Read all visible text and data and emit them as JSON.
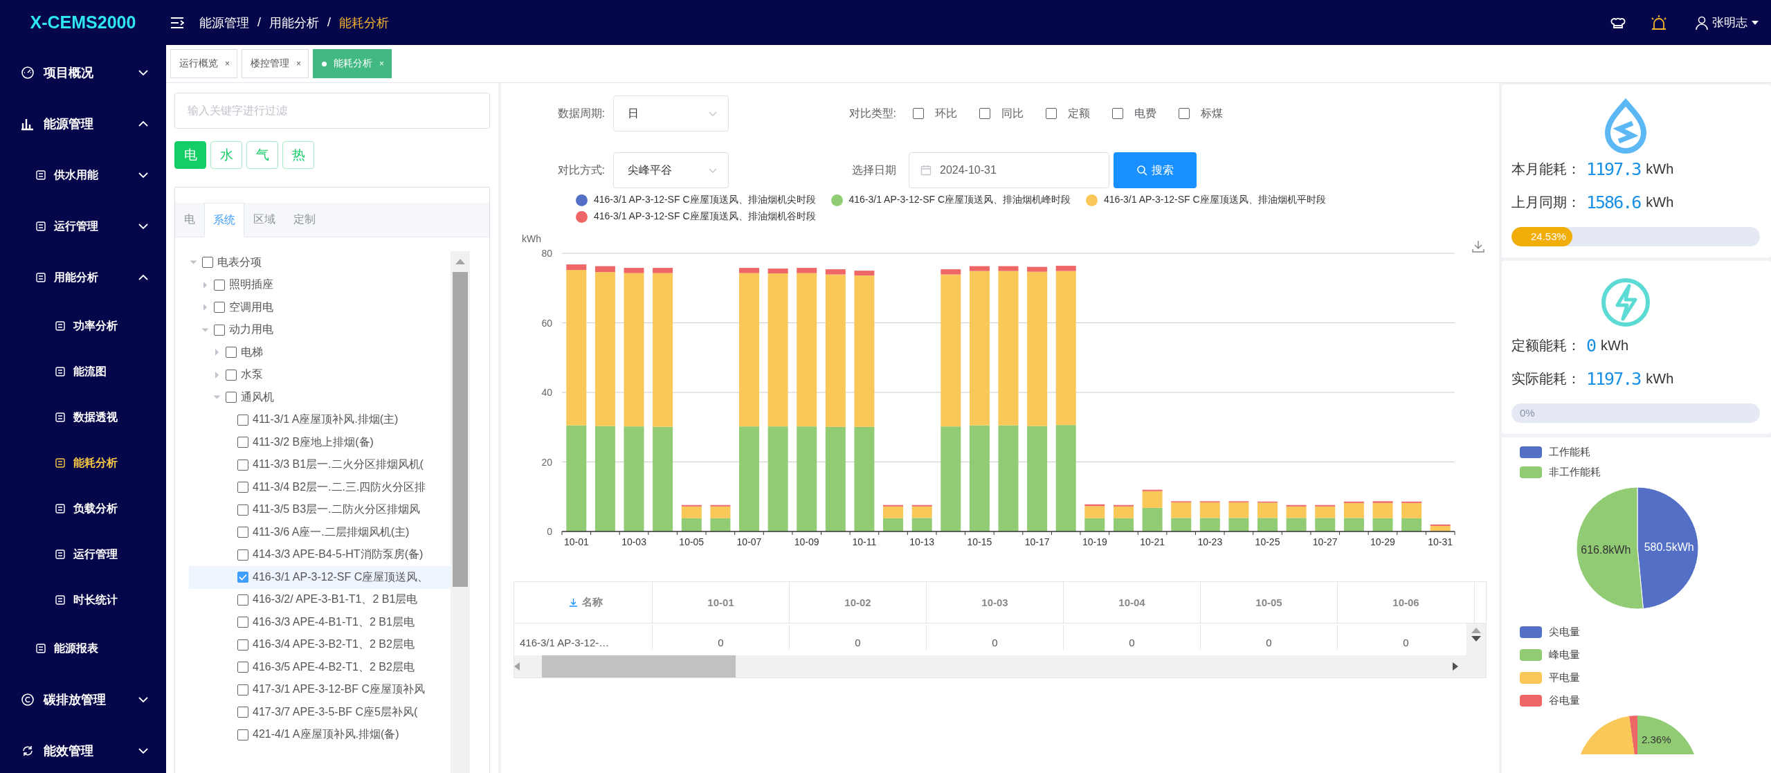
{
  "header": {
    "logo": "X-CEMS2000",
    "breadcrumb": [
      {
        "label": "能源管理",
        "selected": false
      },
      {
        "label": "用能分析",
        "selected": false
      },
      {
        "label": "能耗分析",
        "selected": true
      }
    ],
    "separator": "/",
    "user": "张明志"
  },
  "sidebar": {
    "items": [
      {
        "label": "项目概况",
        "expanded": false,
        "selected": false
      },
      {
        "label": "能源管理",
        "expanded": true,
        "selected": false,
        "children": [
          {
            "label": "供水用能",
            "expanded": false,
            "selected": false
          },
          {
            "label": "运行管理",
            "expanded": false,
            "selected": false
          },
          {
            "label": "用能分析",
            "expanded": true,
            "selected": false,
            "children": [
              {
                "label": "功率分析",
                "selected": false
              },
              {
                "label": "能流图",
                "selected": false
              },
              {
                "label": "数据透视",
                "selected": false
              },
              {
                "label": "能耗分析",
                "selected": true
              },
              {
                "label": "负载分析",
                "selected": false
              },
              {
                "label": "运行管理",
                "selected": false
              },
              {
                "label": "时长统计",
                "selected": false
              }
            ]
          },
          {
            "label": "能源报表",
            "selected": false
          }
        ]
      },
      {
        "label": "碳排放管理",
        "expanded": false,
        "selected": false
      },
      {
        "label": "能效管理",
        "expanded": false,
        "selected": false
      }
    ]
  },
  "tabs": [
    {
      "label": "运行概览",
      "close": "×",
      "selected": false
    },
    {
      "label": "楼控管理",
      "close": "×",
      "selected": false
    },
    {
      "label": "能耗分析",
      "close": "×",
      "selected": true
    }
  ],
  "left_panel": {
    "filter": {
      "placeholder": "输入关键字进行过滤"
    },
    "energy_types": [
      {
        "label": "电",
        "selected": true
      },
      {
        "label": "水",
        "selected": false
      },
      {
        "label": "气",
        "selected": false
      },
      {
        "label": "热",
        "selected": false
      }
    ],
    "tree_tabs": [
      {
        "label": "电",
        "selected": false
      },
      {
        "label": "系统",
        "selected": true
      },
      {
        "label": "区域",
        "selected": false
      },
      {
        "label": "定制",
        "selected": false
      }
    ],
    "tree": [
      {
        "label": "电表分项",
        "checked": false,
        "selected": false,
        "expanded": true,
        "children": [
          {
            "label": "照明插座",
            "checked": false,
            "selected": false,
            "expanded": false
          },
          {
            "label": "空调用电",
            "checked": false,
            "selected": false,
            "expanded": false
          },
          {
            "label": "动力用电",
            "checked": false,
            "selected": false,
            "expanded": true,
            "children": [
              {
                "label": "电梯",
                "checked": false,
                "selected": false,
                "expanded": false
              },
              {
                "label": "水泵",
                "checked": false,
                "selected": false,
                "expanded": false
              },
              {
                "label": "通风机",
                "checked": false,
                "selected": false,
                "expanded": true,
                "children": [
                  {
                    "label": "411-3/1 A座屋顶补风.排烟(主)",
                    "checked": false,
                    "selected": false
                  },
                  {
                    "label": "411-3/2 B座地上排烟(备)",
                    "checked": false,
                    "selected": false
                  },
                  {
                    "label": "411-3/3 B1层一.二火分区排烟风机(",
                    "checked": false,
                    "selected": false
                  },
                  {
                    "label": "411-3/4 B2层一.二.三.四防火分区排",
                    "checked": false,
                    "selected": false
                  },
                  {
                    "label": "411-3/5 B3层一.二防火分区排烟风",
                    "checked": false,
                    "selected": false
                  },
                  {
                    "label": "411-3/6 A座一.二层排烟风机(主)",
                    "checked": false,
                    "selected": false
                  },
                  {
                    "label": "414-3/3 APE-B4-5-HT消防泵房(备)",
                    "checked": false,
                    "selected": false
                  },
                  {
                    "label": "416-3/1 AP-3-12-SF C座屋顶送风、",
                    "checked": true,
                    "selected": true
                  },
                  {
                    "label": "416-3/2/ APE-3-B1-T1、2 B1层电",
                    "checked": false,
                    "selected": false
                  },
                  {
                    "label": "416-3/3 APE-4-B1-T1、2 B1层电",
                    "checked": false,
                    "selected": false
                  },
                  {
                    "label": "416-3/4 APE-3-B2-T1、2 B2层电",
                    "checked": false,
                    "selected": false
                  },
                  {
                    "label": "416-3/5 APE-4-B2-T1、2 B2层电",
                    "checked": false,
                    "selected": false
                  },
                  {
                    "label": "417-3/1 APE-3-12-BF C座屋顶补风",
                    "checked": false,
                    "selected": false
                  },
                  {
                    "label": "417-3/7 APE-3-5-BF C座5层补风(",
                    "checked": false,
                    "selected": false
                  },
                  {
                    "label": "421-4/1 A座屋顶补风.排烟(备)",
                    "checked": false,
                    "selected": false
                  }
                ]
              }
            ]
          }
        ]
      }
    ]
  },
  "filters": {
    "period": {
      "label": "数据周期:",
      "value": "日"
    },
    "compare_types": {
      "label": "对比类型:",
      "options": [
        {
          "label": "环比",
          "checked": false
        },
        {
          "label": "同比",
          "checked": false
        },
        {
          "label": "定额",
          "checked": false
        },
        {
          "label": "电费",
          "checked": false
        },
        {
          "label": "标煤",
          "checked": false
        }
      ]
    },
    "compare_mode": {
      "label": "对比方式:",
      "value": "尖峰平谷"
    },
    "date": {
      "label": "选择日期",
      "value": "2024-10-31"
    },
    "search_button": "搜索"
  },
  "chart": {
    "chart_data": {
      "type": "bar",
      "stacked": true,
      "ylabel": "kWh",
      "ylim": [
        0,
        80
      ],
      "yticks": [
        0,
        20,
        40,
        60,
        80
      ],
      "grid": true,
      "legend": true,
      "categories": [
        "10-01",
        null,
        "10-03",
        null,
        "10-05",
        null,
        "10-07",
        null,
        "10-09",
        null,
        "10-11",
        null,
        "10-13",
        null,
        "10-15",
        null,
        "10-17",
        null,
        "10-19",
        null,
        "10-21",
        null,
        "10-23",
        null,
        "10-25",
        null,
        "10-27",
        null,
        "10-29",
        null,
        "10-31"
      ],
      "series": [
        {
          "name": "416-3/1 AP-3-12-SF C座屋顶送风、排油烟机尖时段",
          "color": "#5470c6",
          "values": [
            0,
            0,
            0,
            0,
            0,
            0,
            0,
            0,
            0,
            0,
            0,
            0,
            0,
            0,
            0,
            0,
            0,
            0,
            0,
            0,
            0,
            0,
            0,
            0,
            0,
            0,
            0,
            0,
            0,
            0,
            0
          ]
        },
        {
          "name": "416-3/1 AP-3-12-SF C座屋顶送风、排油烟机峰时段",
          "color": "#91cc75",
          "values": [
            30.5,
            30.3,
            30.2,
            30.1,
            3.8,
            3.8,
            30.2,
            30.2,
            30.2,
            30.1,
            30.1,
            3.8,
            3.9,
            30.2,
            30.5,
            30.5,
            30.3,
            30.6,
            3.8,
            3.8,
            6.8,
            3.9,
            3.9,
            3.9,
            3.9,
            3.9,
            3.9,
            3.9,
            3.8,
            3.8,
            0
          ]
        },
        {
          "name": "416-3/1 AP-3-12-SF C座屋顶送风、排油烟机平时段",
          "color": "#fac858",
          "values": [
            44.7,
            44.3,
            44.1,
            44.2,
            3.4,
            3.4,
            44.1,
            44.0,
            44.1,
            43.8,
            43.5,
            3.4,
            3.3,
            43.7,
            44.4,
            44.4,
            44.4,
            44.3,
            3.5,
            3.4,
            4.8,
            4.5,
            4.5,
            4.5,
            4.4,
            3.3,
            3.3,
            4.3,
            4.4,
            4.4,
            1.6
          ]
        },
        {
          "name": "416-3/1 AP-3-12-SF C座屋顶送风、排油烟机谷时段",
          "color": "#ee6666",
          "values": [
            1.6,
            1.7,
            1.5,
            1.5,
            0.4,
            0.4,
            1.5,
            1.4,
            1.5,
            1.5,
            1.4,
            0.4,
            0.4,
            1.5,
            1.4,
            1.4,
            1.4,
            1.5,
            0.5,
            0.4,
            0.4,
            0.3,
            0.3,
            0.3,
            0.3,
            0.4,
            0.4,
            0.4,
            0.5,
            0.4,
            0.4
          ]
        }
      ]
    }
  },
  "table": {
    "columns": [
      "名称",
      "10-01",
      "10-02",
      "10-03",
      "10-04",
      "10-05",
      "10-06"
    ],
    "rows": [
      [
        "416-3/1 AP-3-12-…",
        "0",
        "0",
        "0",
        "0",
        "0",
        "0"
      ]
    ]
  },
  "summary_cards": [
    {
      "kind": "water",
      "rows": [
        {
          "label": "本月能耗：",
          "value": "1197.3",
          "unit": "kWh"
        },
        {
          "label": "上月同期：",
          "value": "1586.6",
          "unit": "kWh"
        }
      ],
      "progress": {
        "level": 0.2453,
        "reading": "24.53%"
      }
    },
    {
      "kind": "power",
      "rows": [
        {
          "label": "定额能耗：",
          "value": "0",
          "unit": "kWh"
        },
        {
          "label": "实际能耗：",
          "value": "1197.3",
          "unit": "kWh"
        }
      ],
      "progress": {
        "level": 0,
        "reading": "0%"
      }
    }
  ],
  "work_pie": {
    "chart_data": {
      "type": "pie",
      "categories": [
        "工作能耗",
        "非工作能耗"
      ],
      "values": [
        580.5,
        616.8
      ],
      "colors": [
        "#5470c6",
        "#91cc75"
      ],
      "legend": true,
      "value_labels": [
        "580.5kWh",
        "616.8kWh"
      ]
    }
  },
  "tou_pie": {
    "legend": [
      {
        "label": "尖电量",
        "color": "#5470c6"
      },
      {
        "label": "峰电量",
        "color": "#91cc75"
      },
      {
        "label": "平电量",
        "color": "#fac858"
      },
      {
        "label": "谷电量",
        "color": "#ee6666"
      }
    ],
    "slice_label": "2.36%"
  }
}
